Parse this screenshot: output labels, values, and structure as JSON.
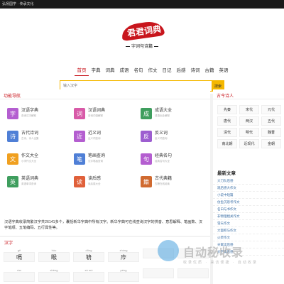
{
  "topbar": {
    "text": "弘扬国学 · 传承文化"
  },
  "logo": {
    "title": "君君词典",
    "subtitle": "字词句诗篇"
  },
  "nav": [
    "首页",
    "字典",
    "词典",
    "成语",
    "名句",
    "作文",
    "日记",
    "后感",
    "诗词",
    "古籍",
    "英语"
  ],
  "search": {
    "placeholder": "输入汉字",
    "button": "搜索"
  },
  "func": {
    "title": "功能导航",
    "items": [
      {
        "label": "汉语字典",
        "sub": "查询汉字解释",
        "icon": "字",
        "color": "#b45ed0"
      },
      {
        "label": "汉语词典",
        "sub": "查询词语解释",
        "icon": "词",
        "color": "#d85aa8"
      },
      {
        "label": "成语大全",
        "sub": "成语出处解释",
        "icon": "成",
        "color": "#3f9e5e"
      },
      {
        "label": "古代诗词",
        "sub": "古诗、诗人全集",
        "icon": "诗",
        "color": "#4f7fd6"
      },
      {
        "label": "近义词",
        "sub": "近义词查询",
        "icon": "近",
        "color": "#b45ed0"
      },
      {
        "label": "反义词",
        "sub": "反义词查询",
        "icon": "反",
        "color": "#9d5ed0"
      },
      {
        "label": "作文大全",
        "sub": "小学作文大全",
        "icon": "文",
        "color": "#f0a020"
      },
      {
        "label": "笔画查询",
        "sub": "汉字笔画查询",
        "icon": "笔",
        "color": "#4f7fd6"
      },
      {
        "label": "经典名句",
        "sub": "经典名句大全",
        "icon": "句",
        "color": "#b45ed0"
      },
      {
        "label": "英语词典",
        "sub": "英语单词查询",
        "icon": "英",
        "color": "#3f9e5e"
      },
      {
        "label": "读后感",
        "sub": "读后感大全",
        "icon": "读",
        "color": "#e0603a"
      },
      {
        "label": "古代典籍",
        "sub": "古籍在线阅读",
        "icon": "籍",
        "color": "#d06a30"
      }
    ]
  },
  "poet": {
    "title": "古今诗人",
    "dynasties": [
      "先秦",
      "宋代",
      "元代",
      "唐代",
      "两汉",
      "五代",
      "清代",
      "明代",
      "魏晋",
      "南北朝",
      "近现代",
      "金朝"
    ]
  },
  "articles": {
    "title": "最新文章",
    "items": [
      "大刀队后感",
      "观后感大作文",
      "小说中短篇",
      "仿鱼沉思考作文",
      "名曰与书作文",
      "非物理相关作文",
      "雪天作文",
      "大面积与作文",
      "火柴作文",
      "天寓读后感",
      "文学读后感"
    ]
  },
  "intro": {
    "text": "汉语字典收录简繁汉字共26141多个，囊括新华字典中所有汉字。新华字典可在线查询汉字的拼音、意思解释、笔画数、汉字笔顺、五笔编码、五行属性等。"
  },
  "hanzi": {
    "title": "汉字",
    "row1": [
      {
        "py": "gē",
        "ch": "嗝"
      },
      {
        "py": "hòu",
        "ch": "睺"
      },
      {
        "py": "dōng",
        "ch": "辀"
      },
      {
        "py": "zhòng",
        "ch": "庈"
      },
      {
        "py": "",
        "ch": ""
      },
      {
        "py": "",
        "ch": ""
      }
    ],
    "row2": [
      {
        "py": "ráo",
        "ch": ""
      },
      {
        "py": "shèng",
        "ch": ""
      },
      {
        "py": "sù mù",
        "ch": ""
      },
      {
        "py": "péng",
        "ch": ""
      },
      {
        "py": "",
        "ch": ""
      },
      {
        "py": "",
        "ch": ""
      }
    ]
  },
  "watermark": {
    "title": "自动秘收录",
    "sub": "收录优质 · 来访便捷 · 自动收录"
  }
}
